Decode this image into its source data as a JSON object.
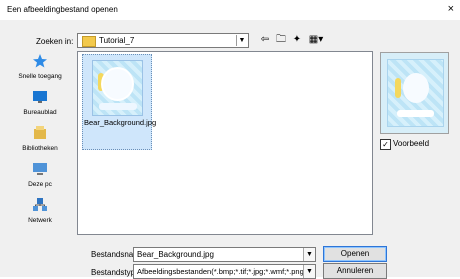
{
  "window": {
    "title": "Een afbeeldingbestand openen",
    "close_label": "×"
  },
  "toolbar": {
    "lookin_label": "Zoeken in:",
    "folder_name": "Tutorial_7",
    "combo_arrow": "▼",
    "tools": [
      "⇦",
      "🗀",
      "✦",
      "▦▾"
    ]
  },
  "places": [
    {
      "label": "Snelle toegang",
      "icon": "star-icon",
      "color": "#2e8be6"
    },
    {
      "label": "Bureaublad",
      "icon": "desktop-icon",
      "color": "#1976d2"
    },
    {
      "label": "Bibliotheken",
      "icon": "library-icon",
      "color": "#e3b84a"
    },
    {
      "label": "Deze pc",
      "icon": "computer-icon",
      "color": "#4f93d8"
    },
    {
      "label": "Netwerk",
      "icon": "network-icon",
      "color": "#2f74c1"
    }
  ],
  "file": {
    "label": "Bear_Background.jpg"
  },
  "preview": {
    "checkbox_label": "Voorbeeld",
    "checked_mark": "✓"
  },
  "form": {
    "filename_label": "Bestandsnaam:",
    "filename_value": "Bear_Background.jpg",
    "filetype_label": "Bestandstypen:",
    "filetype_value": "Afbeeldingsbestanden(*.bmp;*.tif;*.jpg;*.wmf;*.png;*.ep",
    "open_button": "Openen",
    "cancel_button": "Annuleren"
  }
}
